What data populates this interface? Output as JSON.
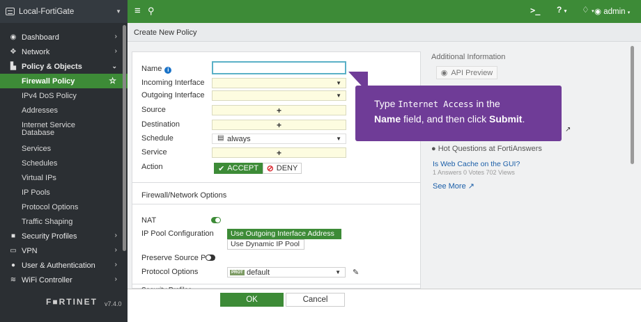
{
  "sidebar": {
    "device_name": "Local-FortiGate",
    "menu": [
      {
        "label": "Dashboard",
        "icon": "dashboard-icon",
        "glyph": "◉"
      },
      {
        "label": "Network",
        "icon": "network-icon",
        "glyph": "✥"
      },
      {
        "label": "Policy & Objects",
        "icon": "policy-icon",
        "glyph": "▙"
      }
    ],
    "policy_items": [
      "Firewall Policy",
      "IPv4 DoS Policy",
      "Addresses",
      "Internet Service Database",
      "Services",
      "Schedules",
      "Virtual IPs",
      "IP Pools",
      "Protocol Options",
      "Traffic Shaping"
    ],
    "menu_after": [
      {
        "label": "Security Profiles",
        "icon": "lock-icon",
        "glyph": "🔒"
      },
      {
        "label": "VPN",
        "icon": "monitor-icon",
        "glyph": "▭"
      },
      {
        "label": "User & Authentication",
        "icon": "user-icon",
        "glyph": "👤"
      },
      {
        "label": "WiFi Controller",
        "icon": "wifi-icon",
        "glyph": "≋"
      }
    ],
    "logo_text": "F■RTINET",
    "version": "v7.4.0"
  },
  "topbar": {
    "cli_glyph": ">_",
    "help_glyph": "?",
    "admin_label": "admin"
  },
  "breadcrumb": "Create New Policy",
  "form": {
    "name_label": "Name",
    "name_value": "",
    "incoming_label": "Incoming Interface",
    "outgoing_label": "Outgoing Interface",
    "source_label": "Source",
    "destination_label": "Destination",
    "schedule_label": "Schedule",
    "schedule_value": "always",
    "service_label": "Service",
    "action_label": "Action",
    "accept_label": "ACCEPT",
    "deny_label": "DENY",
    "section_fw": "Firewall/Network Options",
    "nat_label": "NAT",
    "ippool_label": "IP Pool Configuration",
    "ippool_option1": "Use Outgoing Interface Address",
    "ippool_option2": "Use Dynamic IP Pool",
    "preserve_label": "Preserve Source Port",
    "protocol_label": "Protocol Options",
    "protocol_badge": "PROT",
    "protocol_value": "default",
    "section_security": "Security Profiles"
  },
  "right_panel": {
    "additional_info": "Additional Information",
    "api_preview": "API Preview",
    "hot_questions": "Hot Questions at FortiAnswers",
    "question_link": "Is Web Cache on the GUI?",
    "question_stats": "1 Answers   0 Votes   702 Views",
    "see_more": "See More"
  },
  "tooltip": {
    "line1_prefix": "Type ",
    "line1_code": "Internet Access",
    "line1_suffix": " in the",
    "line2_bold1": "Name",
    "line2_mid": " field, and then click ",
    "line2_bold2": "Submit",
    "line2_end": "."
  },
  "bottom": {
    "ok_label": "OK",
    "cancel_label": "Cancel"
  },
  "colors": {
    "accent_green": "#3d8b37",
    "sidebar_bg": "#2b2f33",
    "tooltip_purple": "#6f3c97",
    "field_yellow": "#fdfce0"
  }
}
